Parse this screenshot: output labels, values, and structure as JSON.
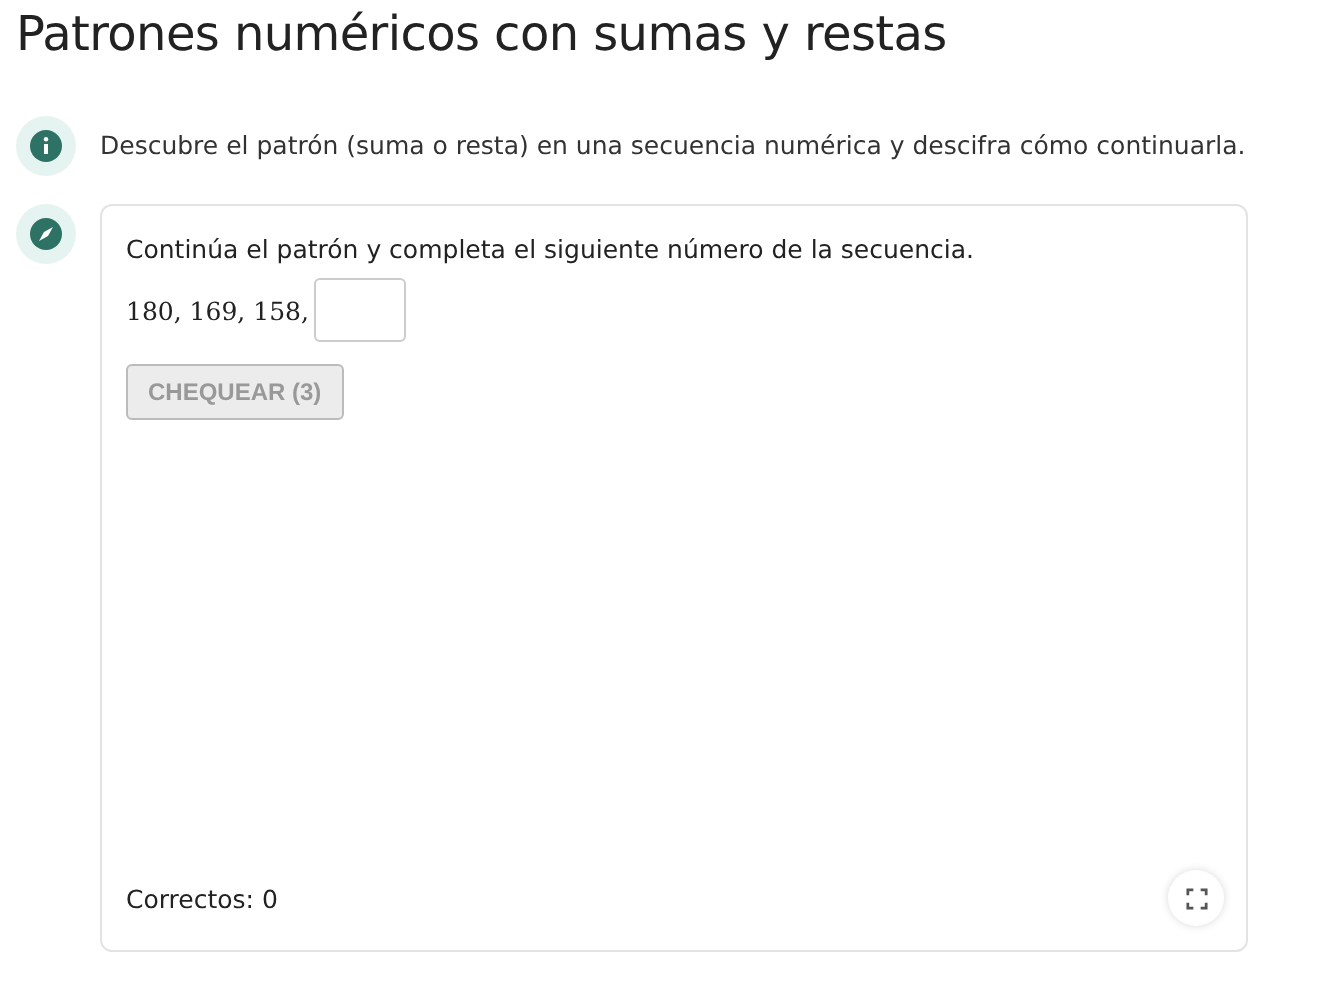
{
  "title": "Patrones numéricos con sumas y restas",
  "intro": {
    "text": "Descubre el patrón (suma o resta) en una secuencia numérica y descifra cómo continuarla."
  },
  "exercise": {
    "prompt": "Continúa el patrón y completa el siguiente número de la secuencia.",
    "sequence": "180, 169, 158,",
    "check_button": {
      "label": "CHEQUEAR (3)",
      "disabled": true
    },
    "score": "Correctos: 0"
  }
}
